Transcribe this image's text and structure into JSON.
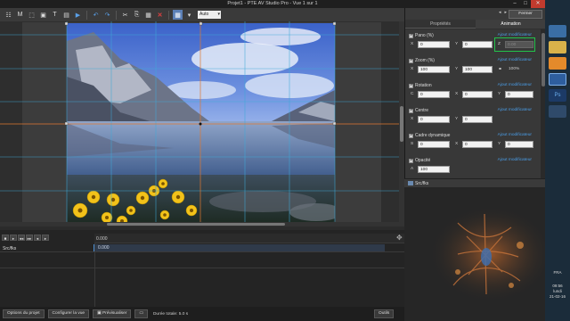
{
  "window": {
    "title": "Projet1 - PTE AV Studio Pro - Vue 1 sur 1",
    "minimize": "–",
    "maximize": "□",
    "close": "✕"
  },
  "toolbar": {
    "zoom_value": "Auto",
    "icons": [
      "objects-icon",
      "text-icon-m",
      "select-icon",
      "frame-icon",
      "text-icon",
      "image-icon",
      "video-icon",
      "undo-icon",
      "redo-icon",
      "cut-icon",
      "copy-icon",
      "paste-icon",
      "delete-icon",
      "grid-icon",
      "guides-icon"
    ]
  },
  "right_panel": {
    "nav_prev": "◂",
    "nav_next": "▸",
    "close_label": "Fermer",
    "tabs": [
      "Propriétés",
      "Animation"
    ],
    "active_tab": 1,
    "groups": {
      "pano": {
        "title": "Pano (%)",
        "link": "Ajout modificateur",
        "x_label": "X",
        "x_value": "0",
        "y_label": "Y",
        "y_value": "0",
        "z_label": "Z",
        "z_value": "0.00"
      },
      "zoom": {
        "title": "Zoom (%)",
        "link": "Ajout modificateur",
        "x_label": "X",
        "x_value": "100",
        "y_label": "Y",
        "y_value": "100",
        "link_icon": "chain-link-icon",
        "result": "100%"
      },
      "rotation": {
        "title": "Rotation",
        "link": "Ajout modificateur",
        "c_label": "C",
        "c_value": "0",
        "x_label": "X",
        "x_value": "0",
        "y_label": "Y",
        "y_value": "0"
      },
      "centre": {
        "title": "Centre",
        "link": "Ajout modificateur",
        "x_label": "X",
        "x_value": "0",
        "y_label": "Y",
        "y_value": "0"
      },
      "cadre": {
        "title": "Cadre dynamique",
        "link": "Ajout modificateur",
        "s_label": "S",
        "s_value": "0",
        "x_label": "X",
        "x_value": "0",
        "y_label": "Y",
        "y_value": "0"
      },
      "opacite": {
        "title": "Opacité",
        "link": "Ajout modificateur",
        "a_label": "A",
        "a_value": "100"
      }
    },
    "source_label": "Src/fks"
  },
  "timeline": {
    "ruler_time": "0.000",
    "track_label": "Src/fks",
    "clip_time": "0.000",
    "buttons": [
      "■",
      "▸",
      "◂◂",
      "▸▸",
      "◂",
      "▸"
    ]
  },
  "bottom": {
    "options_project": "Options du projet",
    "configure_view": "Configurer la vue",
    "preview": "Prévisualiser",
    "duration": "Durée totale: 5.0 s",
    "tools": "Outils"
  },
  "taskbar": {
    "lang": "FRA",
    "time": "09:56",
    "day": "lundi",
    "date": "21-02-16"
  }
}
